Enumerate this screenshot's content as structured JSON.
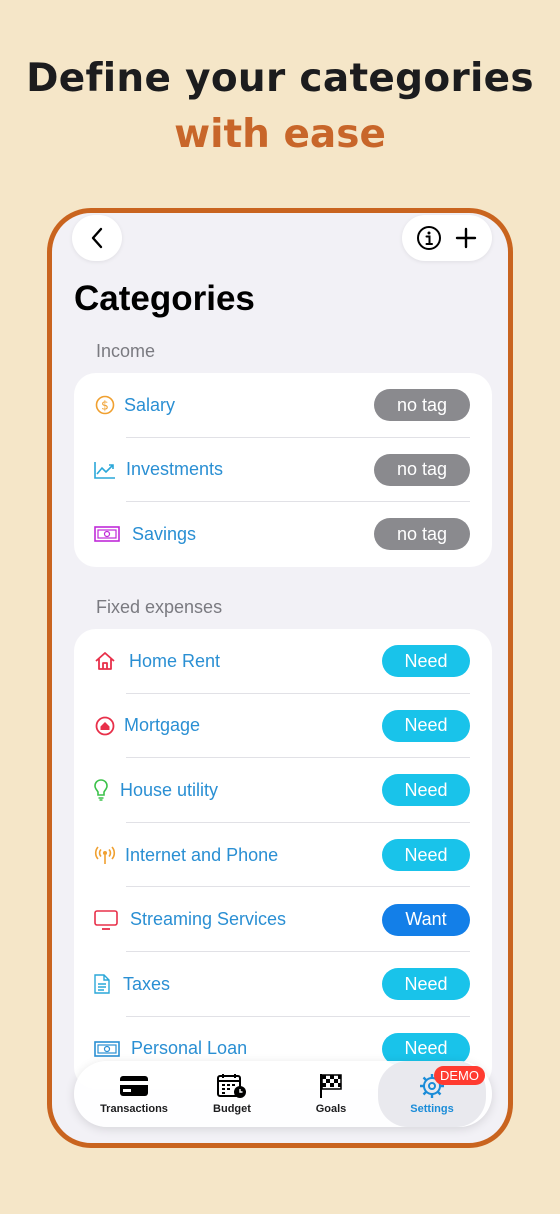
{
  "headline": {
    "line1": "Define your categories",
    "line2": "with ease"
  },
  "page_title": "Categories",
  "sections": [
    {
      "label": "Income",
      "items": [
        {
          "icon": "dollar-coin-icon",
          "label": "Salary",
          "tag": "no tag",
          "tag_style": "gray",
          "icon_color": "#f0a030"
        },
        {
          "icon": "trend-chart-icon",
          "label": "Investments",
          "tag": "no tag",
          "tag_style": "gray",
          "icon_color": "#2aa7d9"
        },
        {
          "icon": "banknote-icon",
          "label": "Savings",
          "tag": "no tag",
          "tag_style": "gray",
          "icon_color": "#c02ad8"
        }
      ]
    },
    {
      "label": "Fixed expenses",
      "items": [
        {
          "icon": "house-icon",
          "label": "Home Rent",
          "tag": "Need",
          "tag_style": "need",
          "icon_color": "#e8304a"
        },
        {
          "icon": "house-circle-icon",
          "label": "Mortgage",
          "tag": "Need",
          "tag_style": "need",
          "icon_color": "#e8304a"
        },
        {
          "icon": "lightbulb-icon",
          "label": "House utility",
          "tag": "Need",
          "tag_style": "need",
          "icon_color": "#3cc24a"
        },
        {
          "icon": "antenna-icon",
          "label": "Internet and Phone",
          "tag": "Need",
          "tag_style": "need",
          "icon_color": "#f0a030"
        },
        {
          "icon": "tv-icon",
          "label": "Streaming Services",
          "tag": "Want",
          "tag_style": "want",
          "icon_color": "#e8304a"
        },
        {
          "icon": "document-icon",
          "label": "Taxes",
          "tag": "Need",
          "tag_style": "need",
          "icon_color": "#2aa7d9"
        },
        {
          "icon": "banknote-icon",
          "label": "Personal Loan",
          "tag": "Need",
          "tag_style": "need",
          "icon_color": "#2a8fd3"
        }
      ]
    }
  ],
  "tabbar": {
    "tabs": [
      {
        "label": "Transactions",
        "icon": "credit-card-icon"
      },
      {
        "label": "Budget",
        "icon": "calendar-clock-icon"
      },
      {
        "label": "Goals",
        "icon": "checkered-flag-icon"
      },
      {
        "label": "Settings",
        "icon": "gear-icon",
        "active": true
      }
    ],
    "badge": "DEMO"
  },
  "colors": {
    "accent": "#c9641f",
    "need": "#19c3ea",
    "want": "#137fe8",
    "no_tag": "#8a8a8e",
    "link": "#2a8fd3"
  }
}
